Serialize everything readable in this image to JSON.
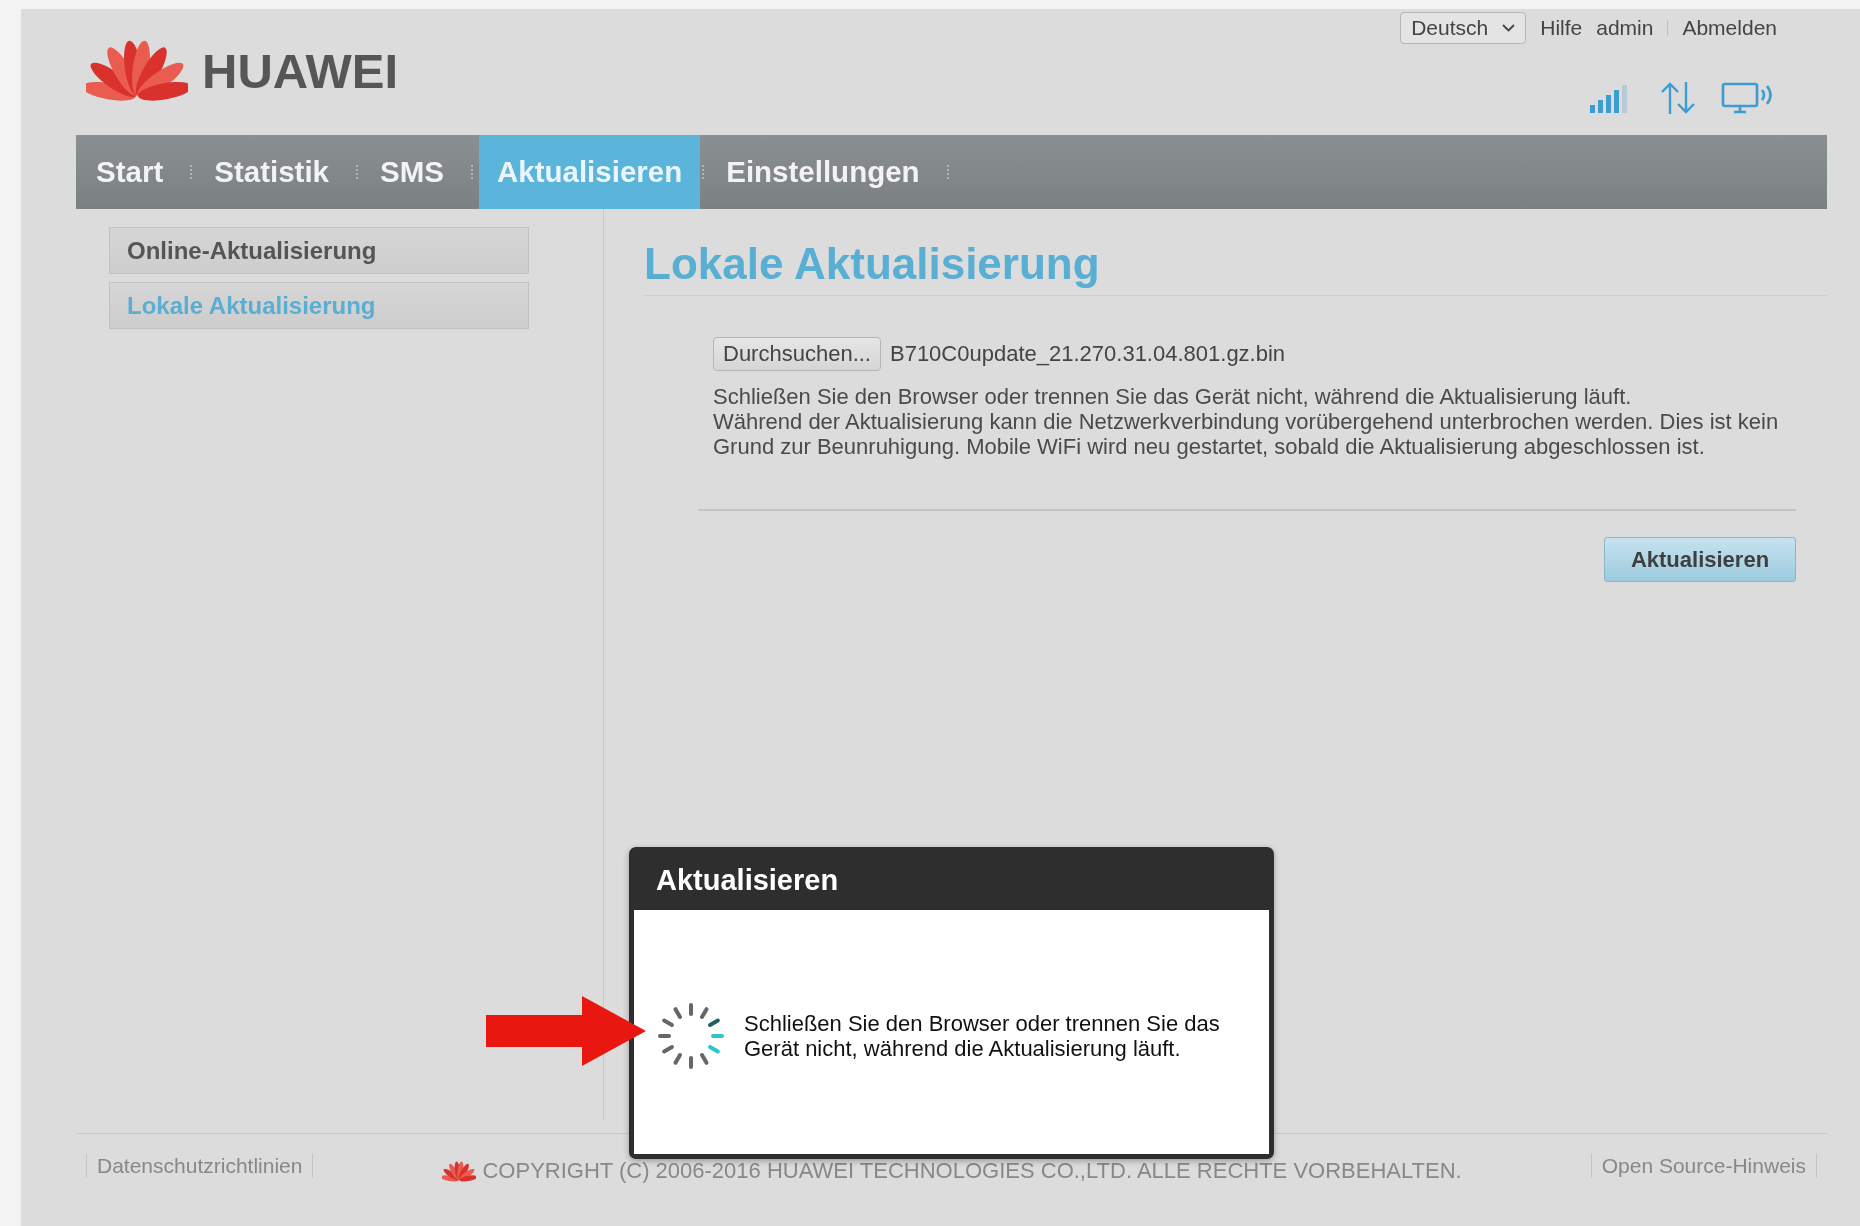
{
  "header": {
    "brand": "HUAWEI",
    "language": "Deutsch",
    "links": [
      "Hilfe",
      "admin",
      "Abmelden"
    ]
  },
  "nav": [
    {
      "label": "Start",
      "selected": false
    },
    {
      "label": "Statistik",
      "selected": false
    },
    {
      "label": "SMS",
      "selected": false
    },
    {
      "label": "Aktualisieren",
      "selected": true
    },
    {
      "label": "Einstellungen",
      "selected": false
    }
  ],
  "sidebar": [
    {
      "label": "Online-Aktualisierung",
      "selected": false
    },
    {
      "label": "Lokale Aktualisierung",
      "selected": true
    }
  ],
  "content": {
    "title": "Lokale Aktualisierung",
    "browse_button": "Durchsuchen...",
    "file_name": "B710C0update_21.270.31.04.801.gz.bin",
    "paragraphs": [
      "Schließen Sie den Browser oder trennen Sie das Gerät nicht, während die Aktualisierung läuft.",
      "Während der Aktualisierung kann die Netzwerkverbindung vorübergehend unterbrochen werden. Dies ist kein Grund zur Beunruhigung. Mobile WiFi wird neu gestartet, sobald die Aktualisierung abgeschlossen ist."
    ],
    "submit_button": "Aktualisieren"
  },
  "dialog": {
    "title": "Aktualisieren",
    "message": "Schließen Sie den Browser oder trennen Sie das Gerät nicht, während die Aktualisierung läuft."
  },
  "footer": {
    "privacy": "Datenschutzrichtlinien",
    "copyright": "COPYRIGHT (C) 2006-2016 HUAWEI TECHNOLOGIES CO.,LTD. ALLE RECHTE VORBEHALTEN.",
    "open_source": "Open Source-Hinweis"
  }
}
